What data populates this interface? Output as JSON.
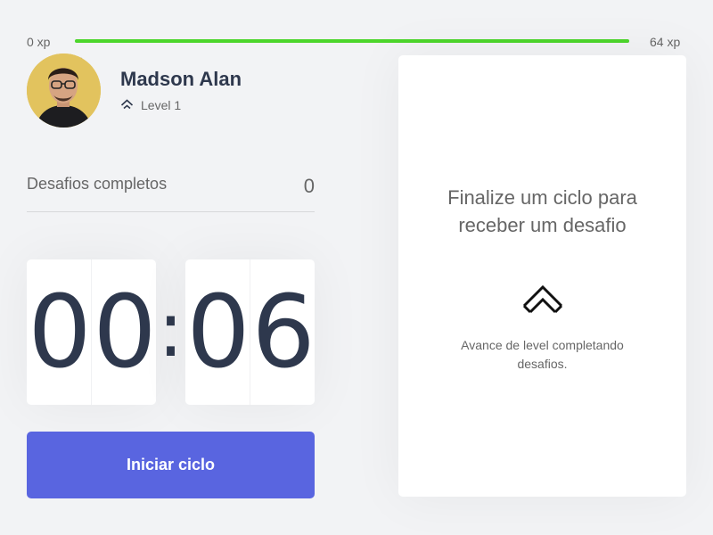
{
  "xp_bar": {
    "min_label": "0 xp",
    "max_label": "64 xp",
    "current_label": "0 xp",
    "progress_fraction": 1.0,
    "fill_color": "#4cd62b"
  },
  "profile": {
    "name": "Madson Alan",
    "level_label": "Level 1",
    "level_icon": "level-up-arrow-icon"
  },
  "challenges": {
    "label": "Desafios completos",
    "count": "0"
  },
  "countdown": {
    "minute_left": "0",
    "minute_right": "0",
    "separator": ":",
    "second_left": "0",
    "second_right": "6"
  },
  "actions": {
    "start_label": "Iniciar ciclo",
    "accent_color": "#5965e0"
  },
  "challenge_box": {
    "title": "Finalize um ciclo para receber um desafio",
    "icon": "level-up-icon",
    "hint": "Avance de level completando desafios."
  }
}
